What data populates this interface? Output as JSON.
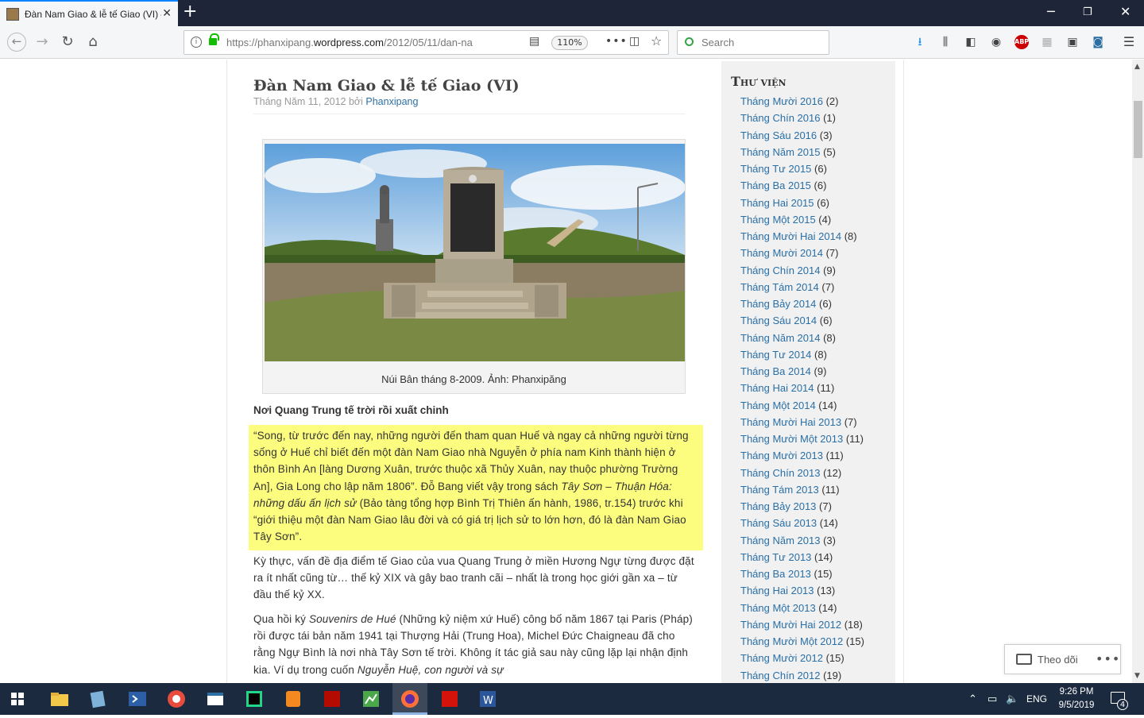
{
  "browser": {
    "tab_title": "Đàn Nam Giao & lễ tế Giao (VI) – P",
    "url_prefix": "https://phanxipang.",
    "url_domain": "wordpress.com",
    "url_path": "/2012/05/11/dan-na",
    "zoom": "110%",
    "search_placeholder": "Search",
    "accent": "#0a84ff"
  },
  "post": {
    "title": "Đàn Nam Giao & lễ tế Giao (VI)",
    "meta_date": "Tháng Năm 11, 2012 bởi ",
    "meta_author": "Phanxipang",
    "caption": "Núi Bân tháng 8-2009. Ảnh: Phanxipăng",
    "subheading": "Nơi Quang Trung tế trời rồi xuất chinh",
    "para1_a": "“Song, từ trước đến nay, những người đến tham quan Huế và ngay cả những người từng sống ở Huế chỉ biết đến một đàn Nam Giao nhà Nguyễn ở phía nam Kinh thành hiện ở thôn Bình An [làng Dương Xuân, trước thuộc xã Thủy Xuân, nay thuộc phường Trường An], Gia Long cho lập năm 1806”. Đỗ Bang viết vậy trong sách ",
    "para1_i": "Tây Sơn – Thuận Hóa: những dấu ấn lịch sử",
    "para1_b": " (Bảo tàng tổng hợp Bình Trị Thiên ấn hành, 1986, tr.154) trước khi “giới thiệu một đàn Nam Giao lâu đời và có giá trị lịch sử to lớn hơn, đó là đàn Nam Giao Tây Sơn”.",
    "para2": "Kỳ thực, vấn đề địa điểm tế Giao của vua Quang Trung ở miền Hương Ngự từng được đặt ra ít nhất cũng từ… thế kỷ XIX và gây bao tranh cãi – nhất là trong học giới gần xa – từ đầu thế kỷ XX.",
    "para3_a": "Qua hồi ký ",
    "para3_i": "Souvenirs de Hué",
    "para3_b": " (Những kỷ niệm xứ Huế) công bố năm 1867 tại Paris (Pháp) rồi được tái bản năm 1941 tại Thượng Hải (Trung Hoa), Michel Đức Chaigneau đã cho rằng Ngự Bình là nơi nhà Tây Sơn tế trời. Không ít tác giả sau này cũng lặp lại nhận định kia. Ví dụ trong cuốn ",
    "para3_i2": "Nguyễn Huệ, con người và sự",
    "highlight_color": "#fcfc7f"
  },
  "sidebar": {
    "title": "Thư viện",
    "archives": [
      {
        "label": "Tháng Mười 2016",
        "count": " (2)"
      },
      {
        "label": "Tháng Chín 2016",
        "count": " (1)"
      },
      {
        "label": "Tháng Sáu 2016",
        "count": " (3)"
      },
      {
        "label": "Tháng Năm 2015",
        "count": " (5)"
      },
      {
        "label": "Tháng Tư 2015",
        "count": " (6)"
      },
      {
        "label": "Tháng Ba 2015",
        "count": " (6)"
      },
      {
        "label": "Tháng Hai 2015",
        "count": " (6)"
      },
      {
        "label": "Tháng Một 2015",
        "count": " (4)"
      },
      {
        "label": "Tháng Mười Hai 2014",
        "count": " (8)"
      },
      {
        "label": "Tháng Mười 2014",
        "count": " (7)"
      },
      {
        "label": "Tháng Chín 2014",
        "count": " (9)"
      },
      {
        "label": "Tháng Tám 2014",
        "count": " (7)"
      },
      {
        "label": "Tháng Bảy 2014",
        "count": " (6)"
      },
      {
        "label": "Tháng Sáu 2014",
        "count": " (6)"
      },
      {
        "label": "Tháng Năm 2014",
        "count": " (8)"
      },
      {
        "label": "Tháng Tư 2014",
        "count": " (8)"
      },
      {
        "label": "Tháng Ba 2014",
        "count": " (9)"
      },
      {
        "label": "Tháng Hai 2014",
        "count": " (11)"
      },
      {
        "label": "Tháng Một 2014",
        "count": " (14)"
      },
      {
        "label": "Tháng Mười Hai 2013",
        "count": " (7)"
      },
      {
        "label": "Tháng Mười Một 2013",
        "count": " (11)"
      },
      {
        "label": "Tháng Mười 2013",
        "count": " (11)"
      },
      {
        "label": "Tháng Chín 2013",
        "count": " (12)"
      },
      {
        "label": "Tháng Tám 2013",
        "count": " (11)"
      },
      {
        "label": "Tháng Bảy 2013",
        "count": " (7)"
      },
      {
        "label": "Tháng Sáu 2013",
        "count": " (14)"
      },
      {
        "label": "Tháng Năm 2013",
        "count": " (3)"
      },
      {
        "label": "Tháng Tư 2013",
        "count": " (14)"
      },
      {
        "label": "Tháng Ba 2013",
        "count": " (15)"
      },
      {
        "label": "Tháng Hai 2013",
        "count": " (13)"
      },
      {
        "label": "Tháng Một 2013",
        "count": " (14)"
      },
      {
        "label": "Tháng Mười Hai 2012",
        "count": " (18)"
      },
      {
        "label": "Tháng Mười Một 2012",
        "count": " (15)"
      },
      {
        "label": "Tháng Mười 2012",
        "count": " (15)"
      },
      {
        "label": "Tháng Chín 2012",
        "count": " (19)"
      }
    ]
  },
  "follow": {
    "label": "Theo dõi",
    "more": "•••"
  },
  "taskbar": {
    "language": "ENG",
    "time": "9:26 PM",
    "date": "9/5/2019",
    "notifications": "4"
  }
}
